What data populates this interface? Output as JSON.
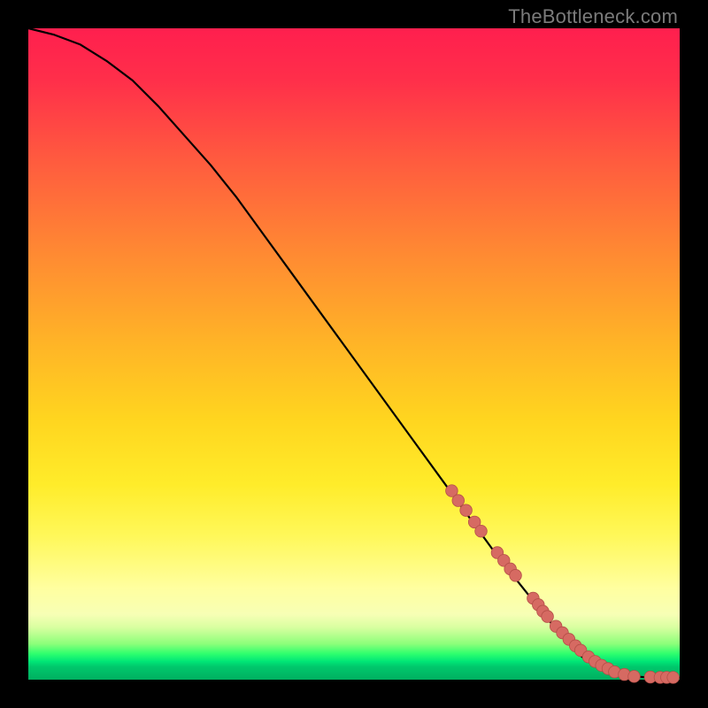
{
  "watermark": "TheBottleneck.com",
  "chart_data": {
    "type": "line",
    "title": "",
    "xlabel": "",
    "ylabel": "",
    "xlim": [
      0,
      100
    ],
    "ylim": [
      0,
      100
    ],
    "grid": false,
    "series": [
      {
        "name": "curve",
        "x": [
          0,
          4,
          8,
          12,
          16,
          20,
          24,
          28,
          32,
          36,
          40,
          44,
          48,
          52,
          56,
          60,
          64,
          68,
          72,
          76,
          80,
          83,
          85,
          87,
          90,
          93,
          96,
          100
        ],
        "y": [
          100,
          99,
          97.5,
          95,
          92,
          88,
          83.5,
          79,
          74,
          68.5,
          63,
          57.5,
          52,
          46.5,
          41,
          35.5,
          30,
          24.5,
          19,
          14,
          9,
          5.5,
          3.5,
          2.2,
          1.0,
          0.5,
          0.3,
          0.3
        ]
      }
    ],
    "scatter": {
      "name": "dots",
      "x": [
        65,
        66,
        67.2,
        68.5,
        69.5,
        72,
        73,
        74,
        74.8,
        77.5,
        78.3,
        79,
        79.7,
        81,
        82,
        83,
        84,
        84.8,
        86,
        87,
        88,
        89,
        90,
        91.5,
        93,
        95.5,
        97,
        98,
        99
      ],
      "y": [
        29,
        27.5,
        26,
        24.2,
        22.8,
        19.5,
        18.3,
        17,
        16,
        12.5,
        11.5,
        10.5,
        9.7,
        8.2,
        7.2,
        6.2,
        5.2,
        4.5,
        3.5,
        2.8,
        2.2,
        1.7,
        1.2,
        0.8,
        0.5,
        0.4,
        0.35,
        0.35,
        0.35
      ]
    },
    "colors": {
      "curve": "#000000",
      "dots_fill": "#d66a62",
      "dots_stroke": "#b54f48",
      "gradient_top": "#ff1f4e",
      "gradient_mid": "#ffec2a",
      "gradient_green": "#00e676"
    }
  }
}
